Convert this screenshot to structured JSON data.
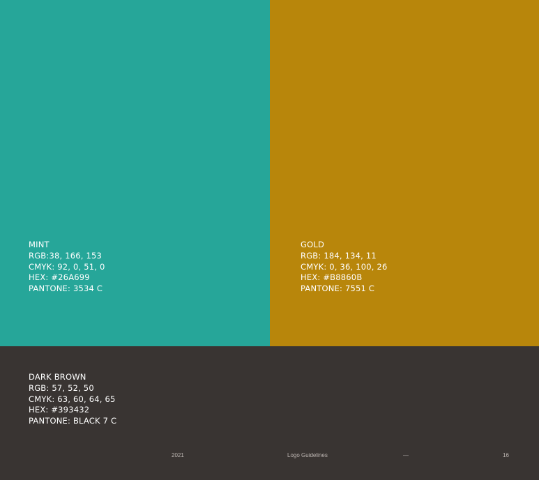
{
  "colors": {
    "mint": "#26A699",
    "gold": "#B8860B",
    "dark_brown": "#393432"
  },
  "swatches": {
    "mint": {
      "name": "MINT",
      "rgb": "RGB:38, 166, 153",
      "cmyk": "CMYK: 92, 0, 51, 0",
      "hex": "HEX: #26A699",
      "pantone": "PANTONE: 3534 C"
    },
    "gold": {
      "name": "GOLD",
      "rgb": "RGB: 184, 134, 11",
      "cmyk": "CMYK: 0, 36, 100, 26",
      "hex": "HEX: #B8860B",
      "pantone": "PANTONE: 7551 C"
    },
    "dark_brown": {
      "name": "DARK BROWN",
      "rgb": "RGB: 57, 52, 50",
      "cmyk": "CMYK: 63, 60, 64, 65",
      "hex": "HEX: #393432",
      "pantone": "PANTONE: BLACK 7 C"
    }
  },
  "footer": {
    "year": "2021",
    "document_title": "Logo Guidelines",
    "separator": "—",
    "page_number": "16"
  }
}
